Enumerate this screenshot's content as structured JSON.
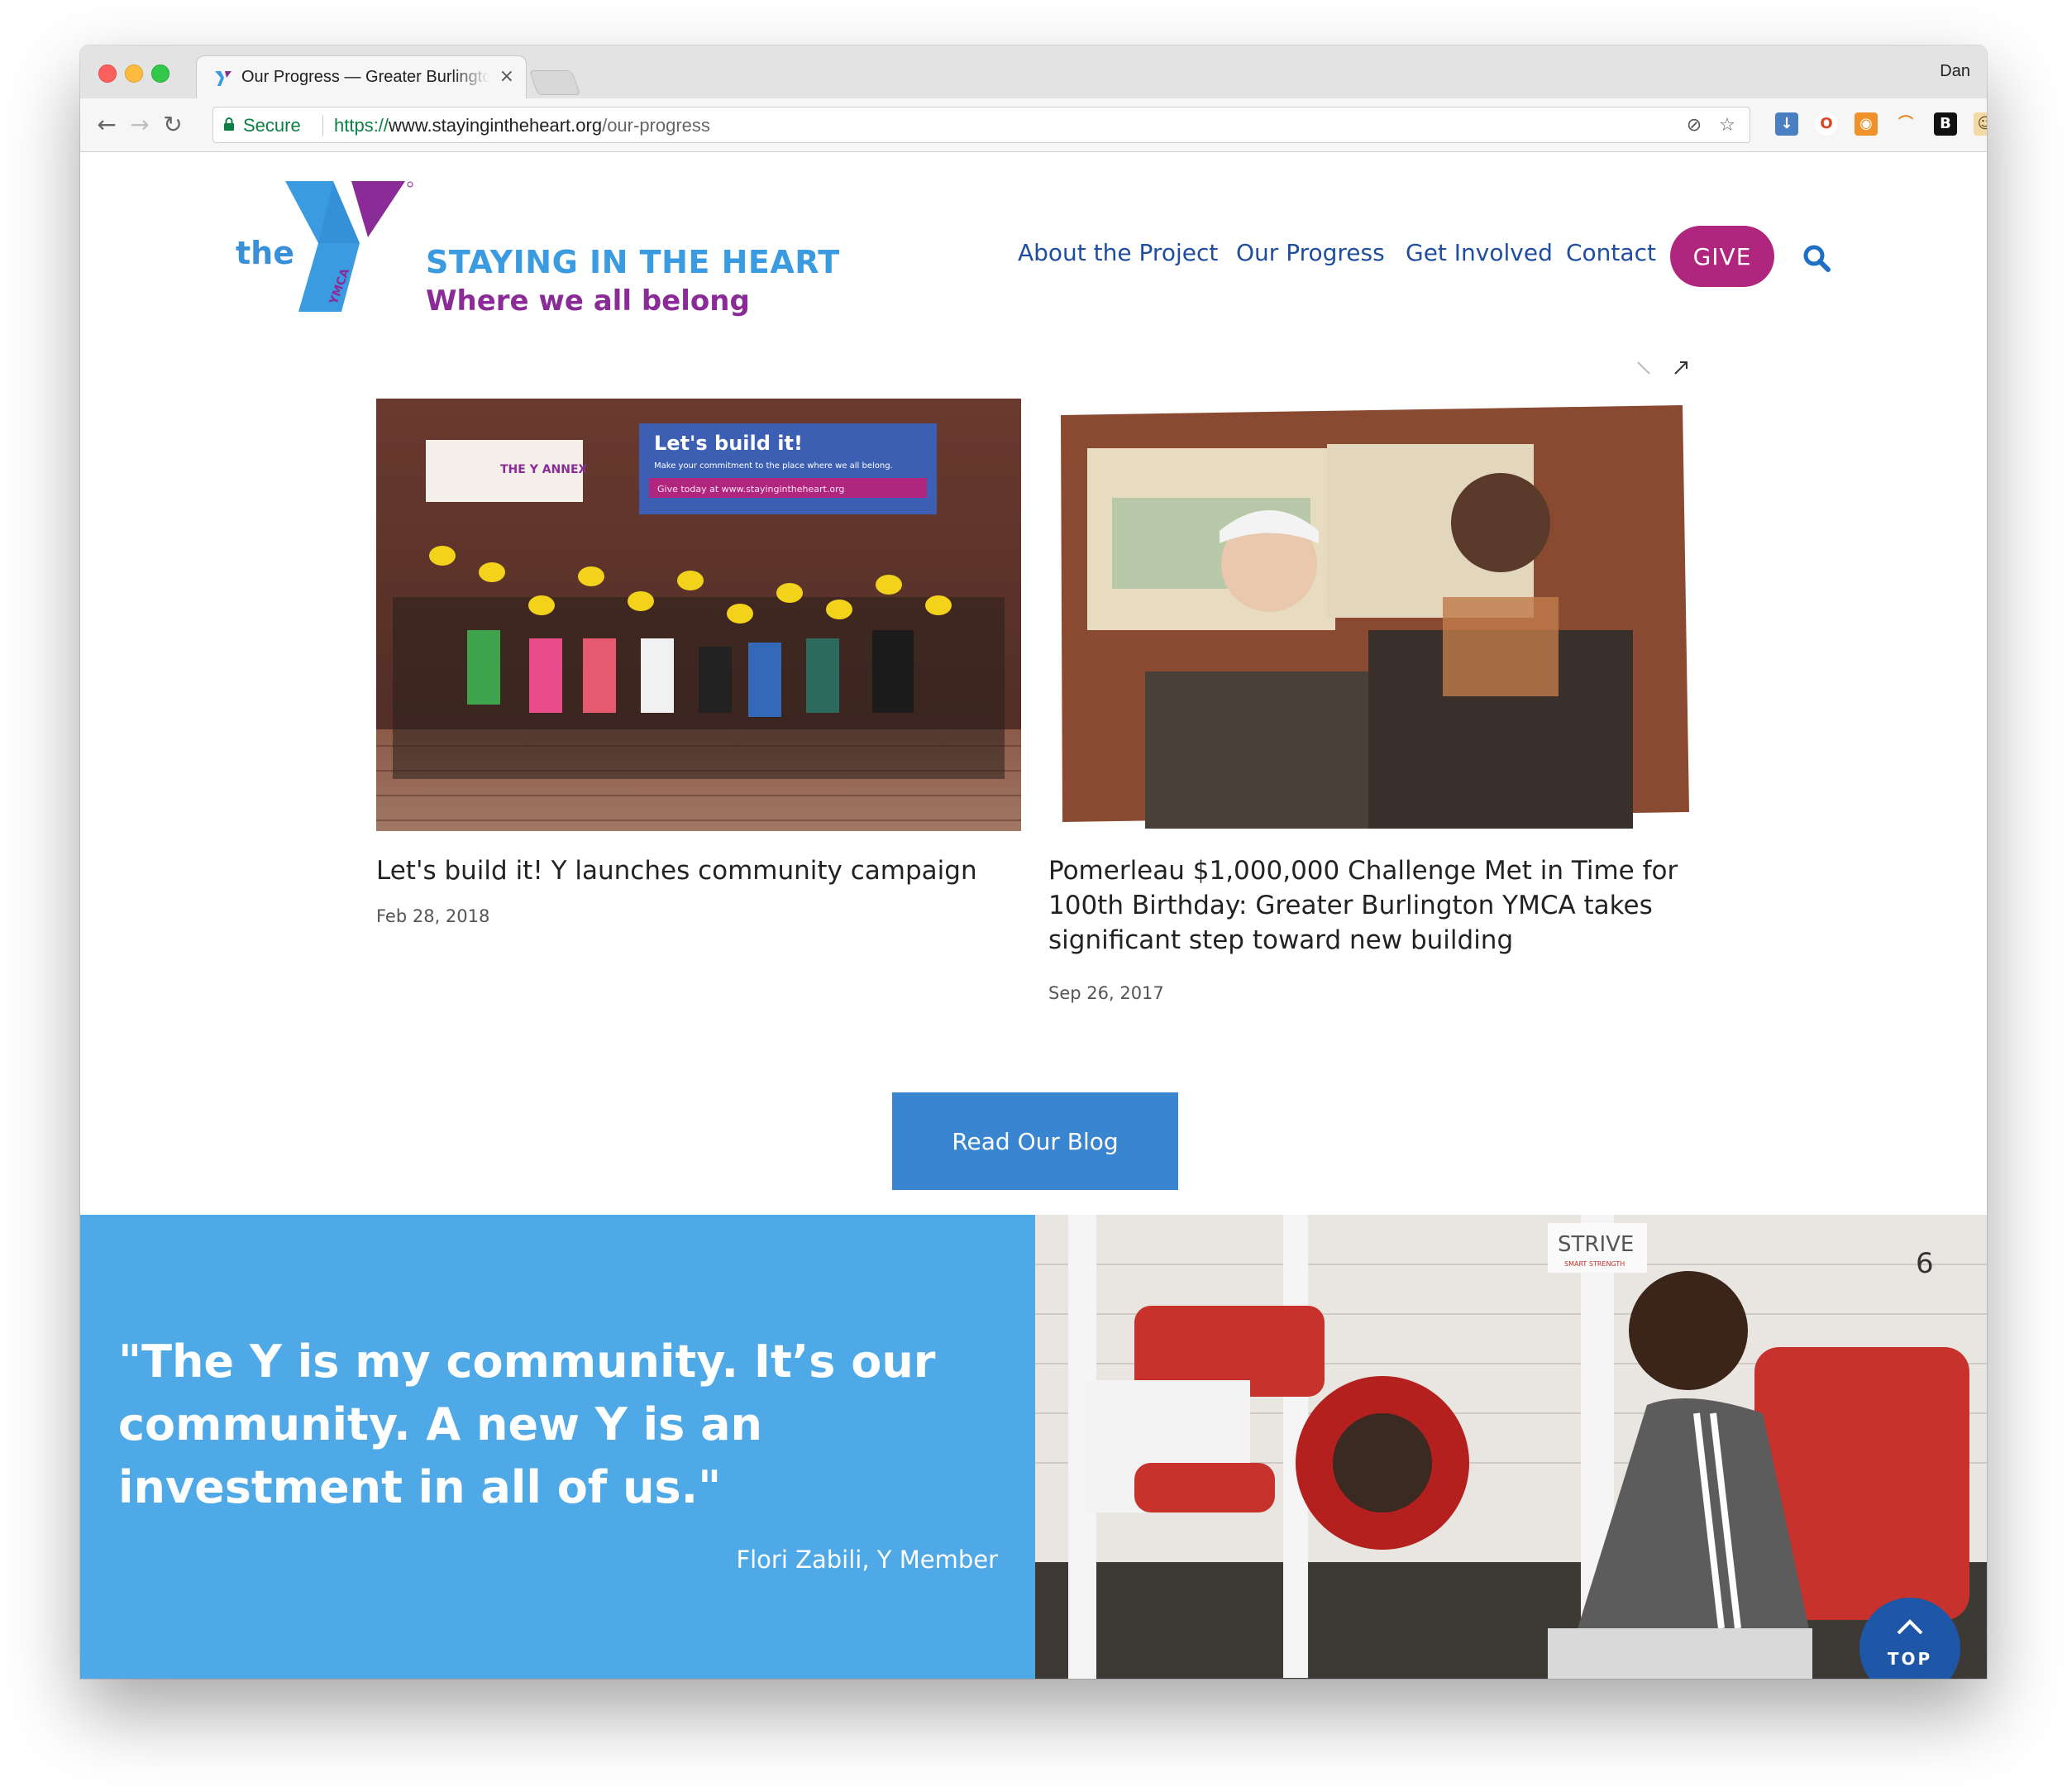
{
  "browser": {
    "tab_title": "Our Progress — Greater Burlington YMCA",
    "user_name": "Dan",
    "secure_label": "Secure",
    "url_scheme": "https://",
    "url_host": "www.stayingintheheart.org",
    "url_path": "/our-progress"
  },
  "site": {
    "logo_the": "the",
    "tagline_line1": "STAYING IN THE HEART",
    "tagline_line2": "Where we all belong",
    "nav": [
      "About the Project",
      "Our Progress",
      "Get Involved",
      "Contact"
    ],
    "give_label": "GIVE"
  },
  "posts": [
    {
      "title": "Let's build it! Y launches community campaign",
      "date": "Feb 28, 2018",
      "image_banner": "Let's build it!",
      "image_banner_sub": "Make your commitment to the place where we all belong.",
      "image_banner_give": "Give today at www.stayingintheheart.org",
      "image_sign": "THE Y ANNEX"
    },
    {
      "title": "Pomerleau $1,000,000 Challenge Met in Time for 100th Birthday: Greater Burlington YMCA takes significant step toward new building",
      "date": "Sep 26, 2017"
    }
  ],
  "blog_button": "Read Our Blog",
  "testimonial": {
    "quote": "\"The Y is my community. It’s our community. A new Y is an investment in all of us.\"",
    "author": "Flori Zabili, Y Member",
    "photo_sign": "STRIVE",
    "photo_sign_sub": "SMART STRENGTH",
    "photo_number": "6"
  },
  "top_button": "TOP",
  "colors": {
    "brand_blue": "#3a9be0",
    "brand_purple": "#8a2b98",
    "nav_blue": "#1f4ea1",
    "give_magenta": "#b0257e",
    "button_blue": "#3a85d0",
    "quote_blue": "#4ea9e6",
    "top_button_blue": "#1e57a8"
  }
}
